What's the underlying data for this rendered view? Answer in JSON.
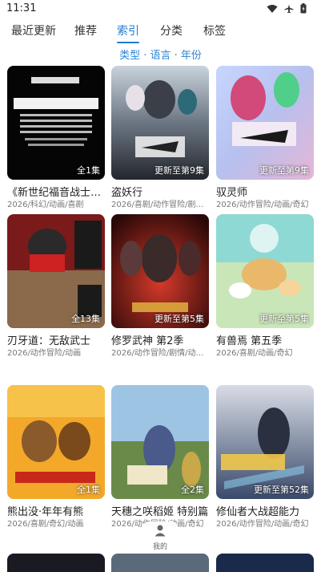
{
  "status": {
    "time": "11:31"
  },
  "tabs": [
    {
      "label": "最近更新"
    },
    {
      "label": "推荐"
    },
    {
      "label": "索引"
    },
    {
      "label": "分类"
    },
    {
      "label": "标签"
    }
  ],
  "filter": {
    "label": "类型 · 语言 · 年份"
  },
  "cards": [
    {
      "title": "《新世纪福音战士…",
      "meta": "2026/科幻/动画/喜剧",
      "badge": "全1集"
    },
    {
      "title": "盗妖行",
      "meta": "2026/喜剧/动作冒险/剧…",
      "badge": "更新至第9集"
    },
    {
      "title": "驭灵师",
      "meta": "2026/动作冒险/动画/奇幻",
      "badge": "更新至第9集"
    },
    {
      "title": "刃牙道：无敌武士",
      "meta": "2026/动作冒险/动画",
      "badge": "全13集"
    },
    {
      "title": "修罗武神 第2季",
      "meta": "2026/动作冒险/剧情/动…",
      "badge": "更新至第5集"
    },
    {
      "title": "有兽焉 第五季",
      "meta": "2026/喜剧/动画/奇幻",
      "badge": "更新至第5集"
    },
    {
      "title": "熊出没·年年有熊",
      "meta": "2026/喜剧/奇幻/动画",
      "badge": "全1集"
    },
    {
      "title": "天穗之咲稻姬 特别篇",
      "meta": "2026/动作冒险/动画/奇幻",
      "badge": "全2集"
    },
    {
      "title": "修仙者大战超能力",
      "meta": "2026/动作冒险/动画/奇幻",
      "badge": "更新至第52集"
    }
  ],
  "bottom": {
    "me_label": "我的"
  },
  "colors": {
    "accent": "#1f7bd0",
    "link": "#2b85d6"
  }
}
